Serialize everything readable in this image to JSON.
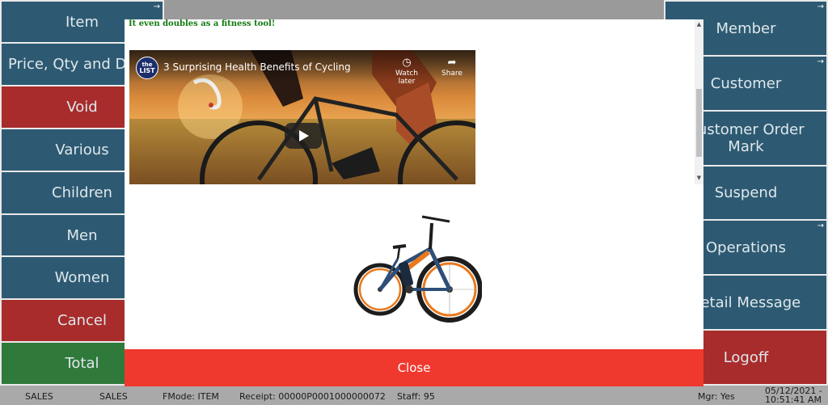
{
  "left_menu": [
    {
      "label": "Item",
      "color": "#2d5a72"
    },
    {
      "label": "Price, Qty and Disc",
      "color": "#2d5a72"
    },
    {
      "label": "Void",
      "color": "#a82c2b"
    },
    {
      "label": "Various",
      "color": "#2d5a72"
    },
    {
      "label": "Children",
      "color": "#2d5a72"
    },
    {
      "label": "Men",
      "color": "#2d5a72"
    },
    {
      "label": "Women",
      "color": "#2d5a72"
    },
    {
      "label": "Cancel",
      "color": "#a82c2b"
    },
    {
      "label": "Total",
      "color": "#2f7a3a"
    }
  ],
  "right_menu": [
    {
      "label": "Member"
    },
    {
      "label": "Customer"
    },
    {
      "label_line1": "Customer Order",
      "label_line2": "Mark"
    },
    {
      "label": "Suspend"
    },
    {
      "label": "Operations"
    },
    {
      "label": "Retail Message"
    },
    {
      "label": "Logoff"
    }
  ],
  "corner_icon": "→",
  "modal": {
    "headline": "It even doubles as a fitness tool!",
    "video": {
      "channel_logo_line1": "the",
      "channel_logo_line2": "LIST",
      "title": "3 Surprising Health Benefits of Cycling",
      "watch_later_label": "Watch later",
      "share_label": "Share",
      "icons": {
        "watch_later": "clock-icon",
        "share": "share-icon",
        "play": "play-icon"
      }
    },
    "product_image": "electric-bike-image",
    "close_label": "Close",
    "accent_color": "#f0392e"
  },
  "status_bar": {
    "mode1": "SALES",
    "mode2": "SALES",
    "fmode": "FMode: ITEM",
    "receipt": "Receipt: 00000P0001000000072",
    "staff": "Staff: 95",
    "mgr": "Mgr: Yes",
    "date": "05/12/2021 -",
    "time": "10:51:41 AM"
  }
}
